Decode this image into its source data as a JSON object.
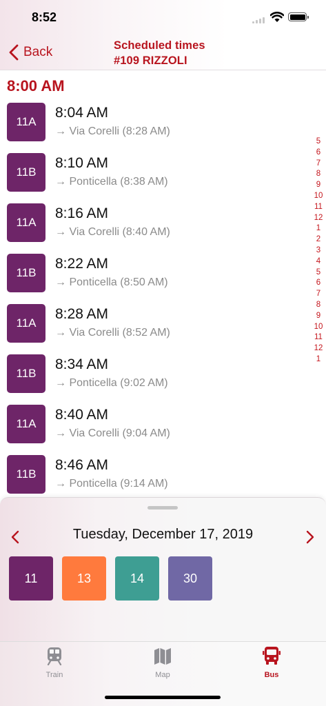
{
  "status_bar": {
    "time": "8:52"
  },
  "nav": {
    "back_label": "Back",
    "title_line1": "Scheduled times",
    "title_line2": "#109 RIZZOLI"
  },
  "hour_label": "8:00 AM",
  "departures": [
    {
      "route": "11A",
      "time": "8:04 AM",
      "destination": "→ Via Corelli (8:28 AM)"
    },
    {
      "route": "11B",
      "time": "8:10 AM",
      "destination": "→ Ponticella (8:38 AM)"
    },
    {
      "route": "11A",
      "time": "8:16 AM",
      "destination": "→ Via Corelli (8:40 AM)"
    },
    {
      "route": "11B",
      "time": "8:22 AM",
      "destination": "→ Ponticella (8:50 AM)"
    },
    {
      "route": "11A",
      "time": "8:28 AM",
      "destination": "→ Via Corelli (8:52 AM)"
    },
    {
      "route": "11B",
      "time": "8:34 AM",
      "destination": "→ Ponticella (9:02 AM)"
    },
    {
      "route": "11A",
      "time": "8:40 AM",
      "destination": "→ Via Corelli (9:04 AM)"
    },
    {
      "route": "11B",
      "time": "8:46 AM",
      "destination": "→ Ponticella (9:14 AM)"
    }
  ],
  "hour_index": [
    "5",
    "6",
    "7",
    "8",
    "9",
    "10",
    "11",
    "12",
    "1",
    "2",
    "3",
    "4",
    "5",
    "6",
    "7",
    "8",
    "9",
    "10",
    "11",
    "12",
    "1"
  ],
  "day_picker": {
    "date": "Tuesday, December 17, 2019",
    "prev_icon": "chevron-left-icon",
    "next_icon": "chevron-right-icon"
  },
  "lines": [
    {
      "label": "11",
      "color": "#6e2568"
    },
    {
      "label": "13",
      "color": "#ff7a3d"
    },
    {
      "label": "14",
      "color": "#3e9e93"
    },
    {
      "label": "30",
      "color": "#7068a5"
    }
  ],
  "tabs": [
    {
      "label": "Train",
      "icon": "train-icon",
      "active": false
    },
    {
      "label": "Map",
      "icon": "map-icon",
      "active": false
    },
    {
      "label": "Bus",
      "icon": "bus-icon",
      "active": true
    }
  ],
  "colors": {
    "accent": "#b8141e",
    "route_tile": "#6e2568",
    "inactive_tab": "#8e8e93"
  }
}
